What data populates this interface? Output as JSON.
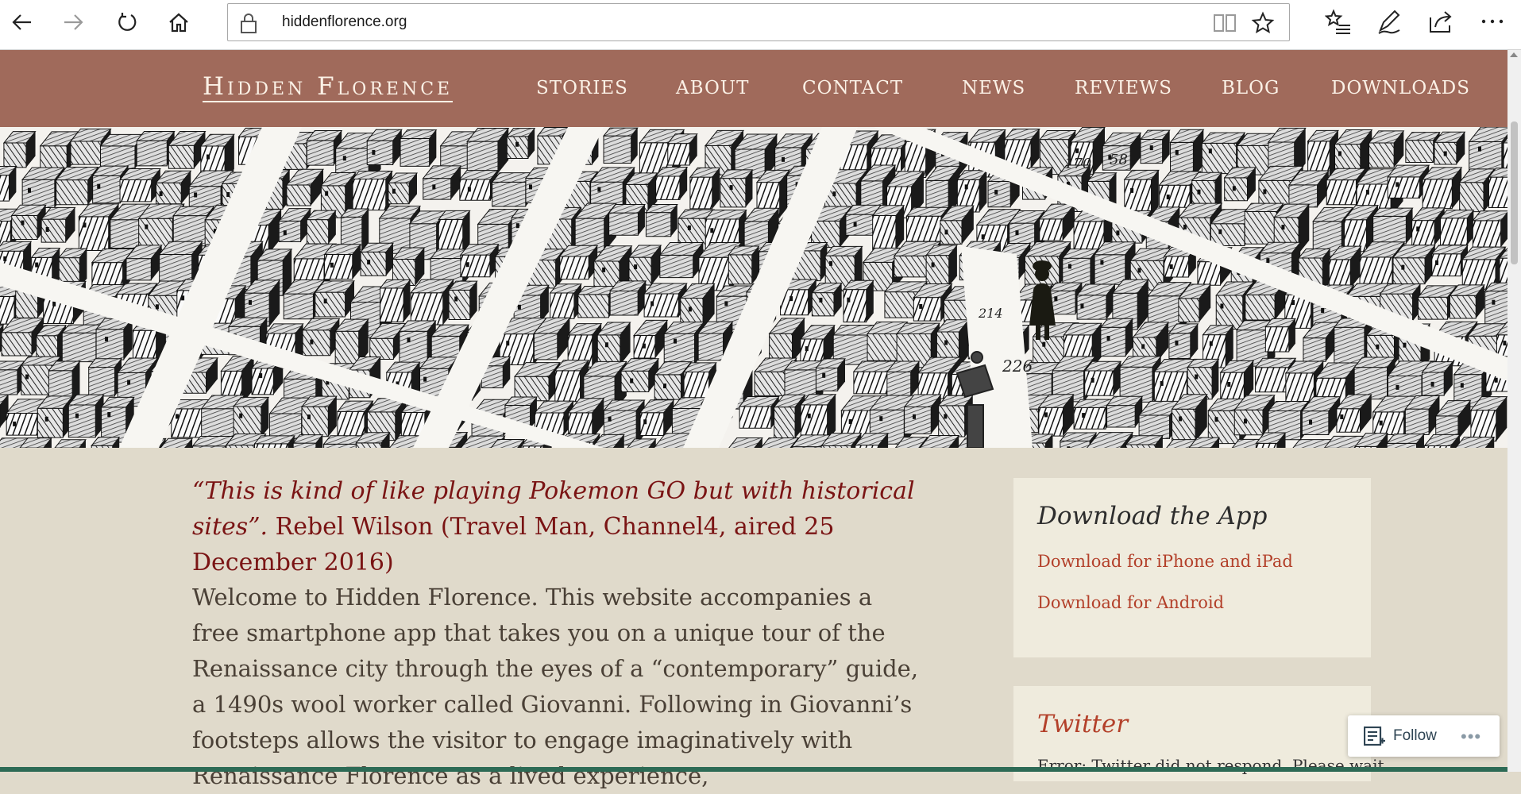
{
  "browser": {
    "url": "hiddenflorence.org",
    "icons": [
      "back-icon",
      "forward-icon",
      "refresh-icon",
      "home-icon",
      "lock-icon",
      "reading-view-icon",
      "favorite-star-icon",
      "favorites-hub-icon",
      "pen-icon",
      "share-icon",
      "more-icon"
    ]
  },
  "site": {
    "logo": "Hidden Florence",
    "menu": [
      "STORIES",
      "ABOUT",
      "CONTACT",
      "NEWS",
      "REVIEWS",
      "BLOG",
      "DOWNLOADS"
    ],
    "header_color": "#a06a5b"
  },
  "hero": {
    "map_numbers": [
      "58",
      "170",
      "226",
      "214"
    ]
  },
  "content": {
    "quote_text": "“This is kind of like playing Pokemon GO but with historical sites”.",
    "quote_attribution": "Rebel Wilson (Travel Man, Channel4, aired 25 December 2016)",
    "intro": "Welcome to Hidden Florence. This website accompanies a free smartphone app that takes you on a unique tour of the Renaissance city through the eyes of a “contemporary” guide, a 1490s wool worker called Giovanni. Following in Giovanni’s footsteps allows the visitor to engage imaginatively with Renaissance Florence as a lived experience,"
  },
  "sidebar": {
    "app_title": "Download the App",
    "iphone_link": "Download for iPhone and iPad",
    "android_link": "Download for Android",
    "twitter_title": "Twitter",
    "twitter_error": "Error: Twitter did not respond. Please wait"
  },
  "follow": {
    "label": "Follow",
    "more": "•••"
  }
}
